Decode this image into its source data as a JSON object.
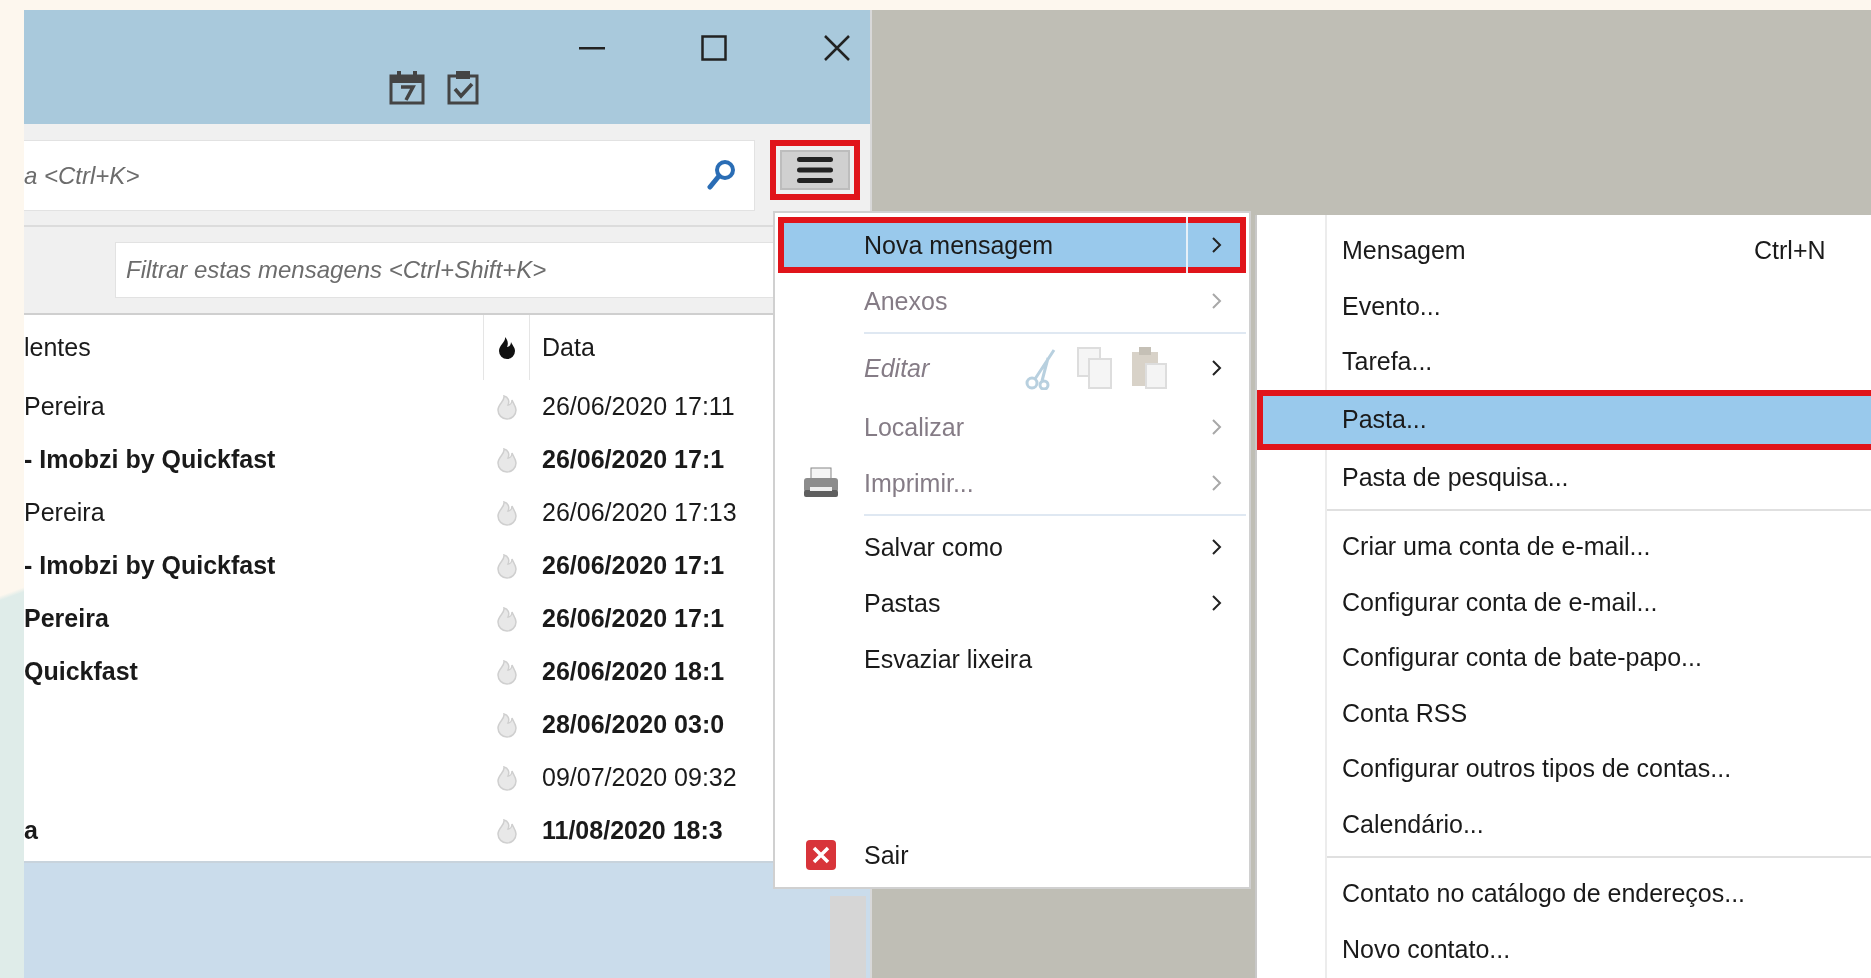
{
  "toolbar": {
    "search": {
      "placeholder": "a <Ctrl+K>"
    },
    "menu_button": {
      "pressed": true,
      "outlined": true
    }
  },
  "filter": {
    "placeholder": "Filtrar estas mensagens <Ctrl+Shift+K>"
  },
  "table": {
    "columns": [
      {
        "kind": "text",
        "label": "lentes"
      },
      {
        "kind": "thread"
      },
      {
        "kind": "text",
        "label": "Data"
      }
    ],
    "rows": [
      {
        "sender": "Pereira",
        "date": "26/06/2020 17:11",
        "unread": false
      },
      {
        "sender": "- Imobzi by Quickfast",
        "date": "26/06/2020 17:1",
        "unread": true
      },
      {
        "sender": "Pereira",
        "date": "26/06/2020 17:13",
        "unread": false
      },
      {
        "sender": "- Imobzi by Quickfast",
        "date": "26/06/2020 17:1",
        "unread": true
      },
      {
        "sender": "Pereira",
        "date": "26/06/2020 17:1",
        "unread": true
      },
      {
        "sender": "Quickfast",
        "date": "26/06/2020 18:1",
        "unread": true
      },
      {
        "date": "28/06/2020 03:0",
        "unread": true
      },
      {
        "date": "09/07/2020 09:32",
        "unread": false
      },
      {
        "sender": "a",
        "date": "11/08/2020 18:3",
        "unread": true
      }
    ]
  },
  "menu": {
    "sections": [
      {
        "divider": false,
        "items": [
          {
            "kind": "text",
            "label": "Nova mensagem",
            "selected": true,
            "disabled": false,
            "submenu": true,
            "outlined": true
          },
          {
            "kind": "text",
            "label": "Anexos",
            "selected": false,
            "disabled": true,
            "submenu": true,
            "outlined": false
          }
        ]
      },
      {
        "divider": true,
        "items": [
          {
            "kind": "clipboard",
            "label": "Editar",
            "selected": false,
            "disabled": true,
            "submenu": true,
            "outlined": false
          },
          {
            "kind": "text",
            "label": "Localizar",
            "selected": false,
            "disabled": true,
            "submenu": true,
            "outlined": false
          },
          {
            "kind": "printer",
            "label": "Imprimir...",
            "selected": false,
            "disabled": true,
            "submenu": true,
            "outlined": false
          }
        ]
      },
      {
        "divider": true,
        "items": [
          {
            "kind": "text",
            "label": "Salvar como",
            "selected": false,
            "disabled": false,
            "submenu": true,
            "outlined": false
          },
          {
            "kind": "text",
            "label": "Pastas",
            "selected": false,
            "disabled": false,
            "submenu": true,
            "outlined": false
          },
          {
            "kind": "text",
            "label": "Esvaziar lixeira",
            "selected": false,
            "disabled": false,
            "submenu": false,
            "outlined": false
          }
        ]
      },
      {
        "divider": false,
        "items": [
          {
            "kind": "quit",
            "label": "Sair",
            "selected": false,
            "disabled": false,
            "submenu": false,
            "outlined": false
          }
        ]
      }
    ]
  },
  "submenu": {
    "sections": [
      {
        "divider": false,
        "items": [
          {
            "label": "Mensagem",
            "shortcut": "Ctrl+N",
            "selected": false,
            "outlined": false
          },
          {
            "label": "Evento...",
            "selected": false,
            "outlined": false
          },
          {
            "label": "Tarefa...",
            "selected": false,
            "outlined": false
          },
          {
            "label": "Pasta...",
            "selected": true,
            "outlined": true
          },
          {
            "label": "Pasta de pesquisa...",
            "selected": false,
            "outlined": false
          }
        ]
      },
      {
        "divider": true,
        "items": [
          {
            "label": "Criar uma conta de e-mail...",
            "selected": false,
            "outlined": false
          },
          {
            "label": "Configurar conta de e-mail...",
            "selected": false,
            "outlined": false
          },
          {
            "label": "Configurar conta de bate-papo...",
            "selected": false,
            "outlined": false
          },
          {
            "label": "Conta RSS",
            "selected": false,
            "outlined": false
          },
          {
            "label": "Configurar outros tipos de contas...",
            "selected": false,
            "outlined": false
          },
          {
            "label": "Calendário...",
            "selected": false,
            "outlined": false
          }
        ]
      },
      {
        "divider": true,
        "items": [
          {
            "label": "Contato no catálogo de endereços...",
            "selected": false,
            "outlined": false
          },
          {
            "label": "Novo contato...",
            "selected": false,
            "outlined": false
          }
        ]
      }
    ]
  }
}
